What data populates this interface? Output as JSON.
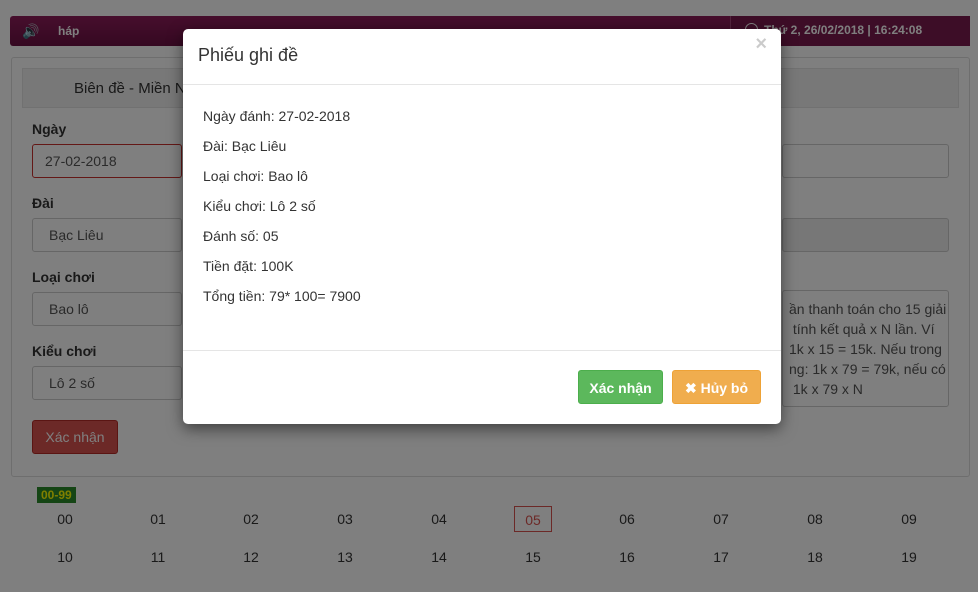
{
  "topbar": {
    "speaker_icon": "🔊",
    "marquee": "háp",
    "datetime": "Thứ 2, 26/02/2018 | 16:24:08"
  },
  "panel": {
    "heading": "Biên đề - Miền N",
    "labels": {
      "date": "Ngày",
      "station": "Đài",
      "game_type": "Loại chơi",
      "play_type": "Kiểu chơi"
    },
    "values": {
      "date": "27-02-2018",
      "station": "Bạc Liêu",
      "game_type": "Bao lô",
      "play_type": "Lô 2 số"
    },
    "note_text": "ần thanh toán cho 15 giải\n tính kết quả x N lần. Ví\n1k x 15 = 15k. Nếu trong\nng: 1k x 79 = 79k, nếu có\n 1k x 79 x N",
    "submit": "Xác nhận"
  },
  "grid": {
    "range_badge": "00-99",
    "rows": [
      [
        "00",
        "01",
        "02",
        "03",
        "04",
        "05",
        "06",
        "07",
        "08",
        "09"
      ],
      [
        "10",
        "11",
        "12",
        "13",
        "14",
        "15",
        "16",
        "17",
        "18",
        "19"
      ]
    ],
    "selected": "05"
  },
  "modal": {
    "title": "Phiếu ghi đề",
    "close": "×",
    "lines": [
      "Ngày đánh: 27-02-2018",
      "Đài: Bạc Liêu",
      "Loại chơi: Bao lô",
      "Kiểu chơi: Lô 2 số",
      "Đánh số: 05",
      "Tiền đặt: 100K",
      "Tổng tiền: 79* 100= 7900"
    ],
    "confirm": "Xác nhận",
    "cancel": "✖ Hủy bỏ"
  },
  "colors": {
    "topbar": "#7b1a4e",
    "confirm_green": "#5cb85c",
    "cancel_orange": "#f0ad4e",
    "submit_red": "#d9534f",
    "range_badge_bg": "#2a8a2a"
  }
}
